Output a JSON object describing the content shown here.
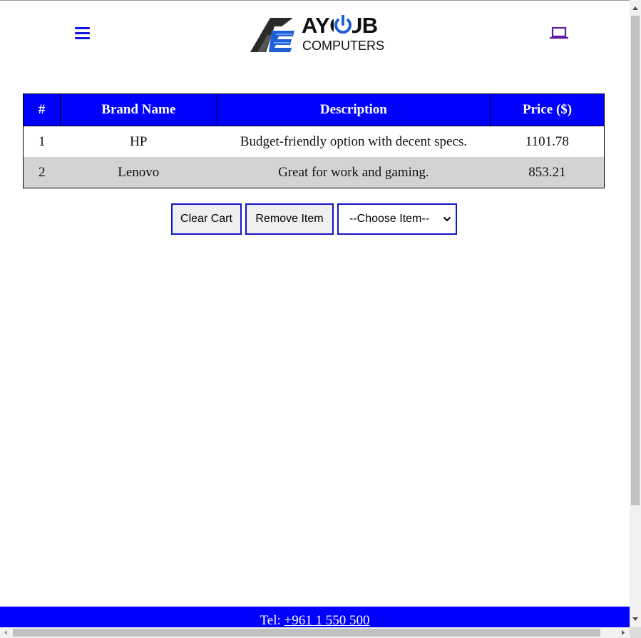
{
  "header": {
    "logo_top": "AYOUB",
    "logo_bottom": "COMPUTERS",
    "menu_icon": "hamburger-menu-icon",
    "cart_icon": "laptop-icon"
  },
  "table": {
    "headers": [
      "#",
      "Brand Name",
      "Description",
      "Price ($)"
    ],
    "rows": [
      {
        "num": "1",
        "brand": "HP",
        "description": "Budget-friendly option with decent specs.",
        "price": "1101.78"
      },
      {
        "num": "2",
        "brand": "Lenovo",
        "description": "Great for work and gaming.",
        "price": "853.21"
      }
    ]
  },
  "controls": {
    "clear_label": "Clear Cart",
    "remove_label": "Remove Item",
    "select_value": "--Choose Item--"
  },
  "footer": {
    "tel_label": "Tel: ",
    "tel_number": "+961 1 550 500"
  },
  "colors": {
    "accent": "#0000ff",
    "row_alt": "#d3d3d3",
    "button_border": "#1414cc",
    "laptop_icon": "#5a1e9e"
  }
}
